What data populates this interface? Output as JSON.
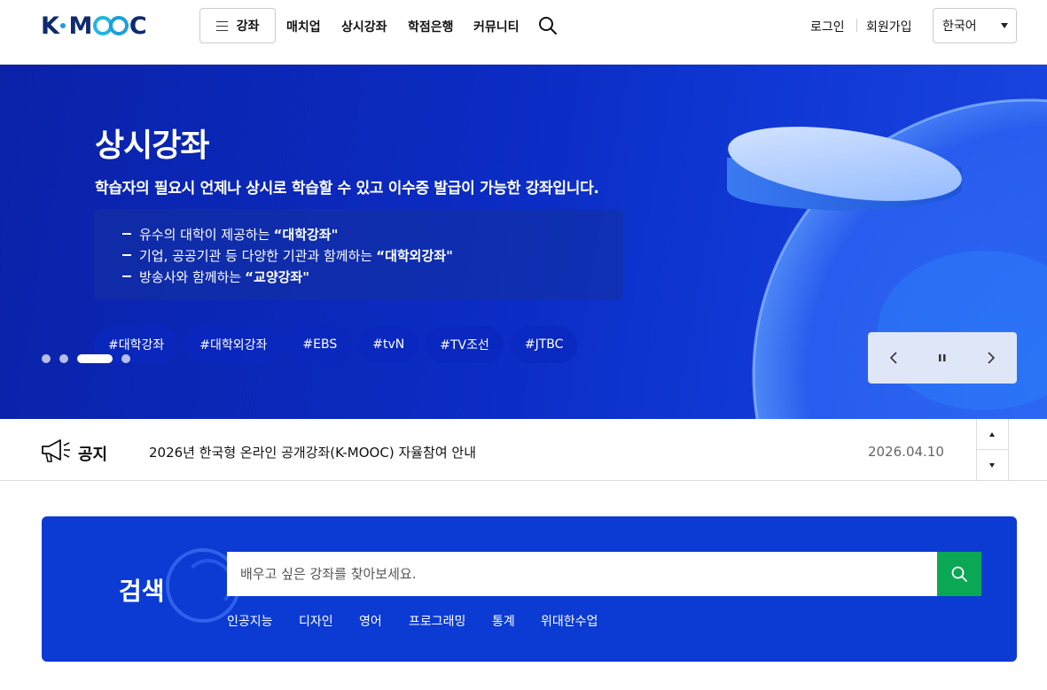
{
  "header": {
    "logo_text": "K-MOOC",
    "menu_label": "강좌",
    "nav": [
      "매치업",
      "상시강좌",
      "학점은행",
      "커뮤니티"
    ],
    "login": "로그인",
    "signup": "회원가입",
    "language": "한국어"
  },
  "hero": {
    "title": "상시강좌",
    "subtitle": "학습자의 필요시 언제나 상시로 학습할 수 있고 이수증 발급이 가능한 강좌입니다.",
    "bullets": [
      {
        "text": "유수의 대학이 제공하는",
        "bold": "“대학강좌\""
      },
      {
        "text": "기업, 공공기관 등 다양한 기관과 함께하는",
        "bold": "“대학외강좌\""
      },
      {
        "text": "방송사와 함께하는",
        "bold": "“교양강좌\""
      }
    ],
    "tags": [
      "#대학강좌",
      "#대학외강좌",
      "#EBS",
      "#tvN",
      "#TV조선",
      "#JTBC"
    ],
    "slide_count": 4,
    "active_slide": 3
  },
  "notice": {
    "label": "공지",
    "text": "2026년 한국형 온라인 공개강좌(K-MOOC) 자율참여 안내",
    "date": "2026.04.10"
  },
  "search": {
    "title": "검색",
    "placeholder": "배우고 싶은 강좌를 찾아보세요.",
    "keywords": [
      "인공지능",
      "디자인",
      "영어",
      "프로그래밍",
      "통계",
      "위대한수업"
    ]
  },
  "colors": {
    "hero_bg": "#0b2bc2",
    "search_bg": "#0b3bd3",
    "search_button": "#0aa854",
    "logo_dark": "#0f2a6e",
    "logo_accent": "#1aa0d8"
  }
}
